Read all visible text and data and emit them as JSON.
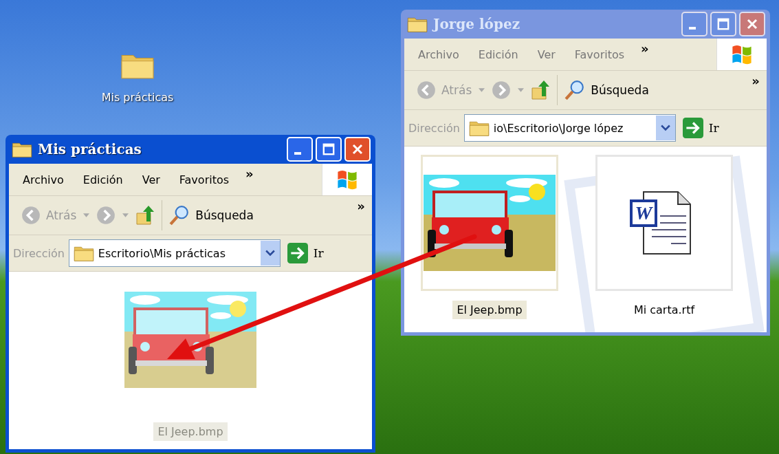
{
  "desktop_icons": [
    {
      "label": "Mis prácticas"
    }
  ],
  "windows": [
    {
      "title": "Jorge lópez",
      "active": false,
      "menu": [
        "Archivo",
        "Edición",
        "Ver",
        "Favoritos"
      ],
      "menu_overflow": "»",
      "back": "Atrás",
      "search": "Búsqueda",
      "toolbar_overflow": "»",
      "address_label": "Dirección",
      "address": "io\\Escritorio\\Jorge lópez",
      "go": "Ir",
      "files": [
        {
          "name": "El Jeep.bmp",
          "kind": "image",
          "selected": true,
          "dragging": false
        },
        {
          "name": "Mi carta.rtf",
          "kind": "document",
          "badge": "W",
          "selected": false,
          "dragging": false
        }
      ]
    },
    {
      "title": "Mis prácticas",
      "active": true,
      "menu": [
        "Archivo",
        "Edición",
        "Ver",
        "Favoritos"
      ],
      "menu_overflow": "»",
      "back": "Atrás",
      "search": "Búsqueda",
      "toolbar_overflow": "»",
      "address_label": "Dirección",
      "address": "Escritorio\\Mis prácticas",
      "go": "Ir",
      "files": [
        {
          "name": "El Jeep.bmp",
          "kind": "image",
          "selected": false,
          "dragging": true
        }
      ]
    }
  ]
}
